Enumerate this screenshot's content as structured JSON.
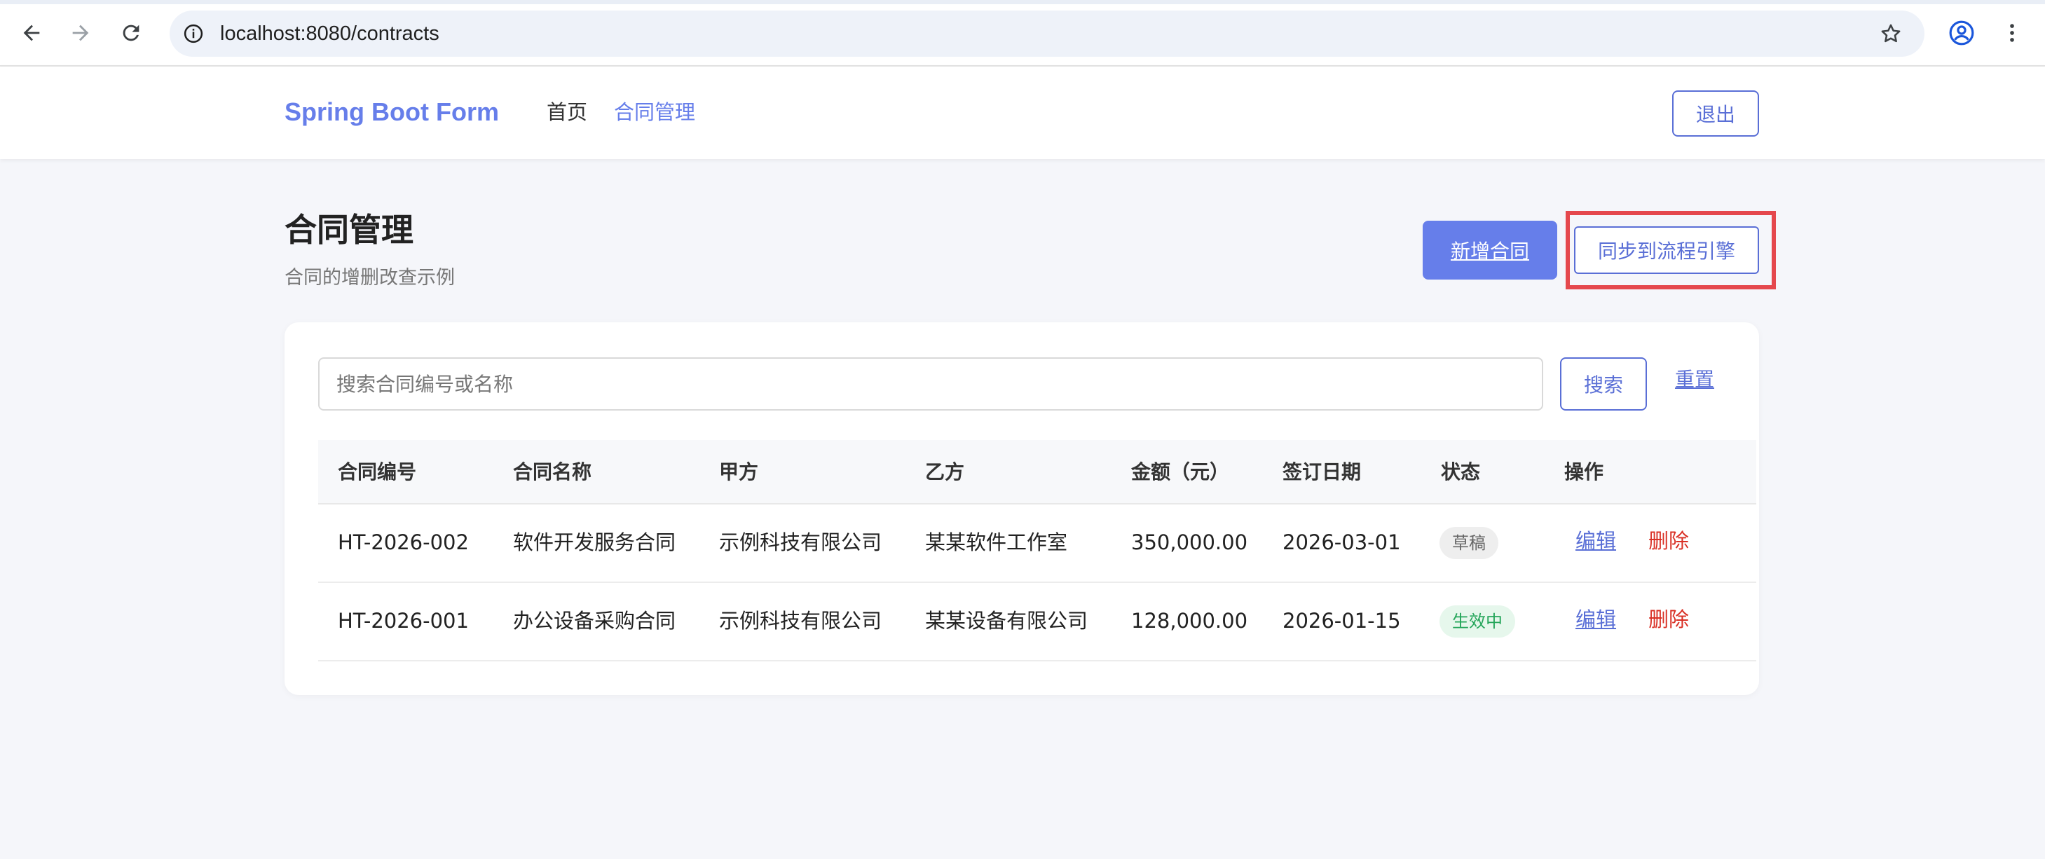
{
  "browser": {
    "url": "localhost:8080/contracts"
  },
  "navbar": {
    "brand": "Spring Boot Form",
    "links": [
      {
        "label": "首页"
      },
      {
        "label": "合同管理"
      }
    ],
    "logout_label": "退出"
  },
  "page": {
    "title": "合同管理",
    "subtitle": "合同的增删改查示例",
    "add_button_label": "新增合同",
    "sync_button_label": "同步到流程引擎"
  },
  "search": {
    "placeholder": "搜索合同编号或名称",
    "search_label": "搜索",
    "reset_label": "重置"
  },
  "table": {
    "headers": [
      "合同编号",
      "合同名称",
      "甲方",
      "乙方",
      "金额（元）",
      "签订日期",
      "状态",
      "操作"
    ],
    "rows": [
      {
        "code": "HT-2026-002",
        "name": "软件开发服务合同",
        "party_a": "示例科技有限公司",
        "party_b": "某某软件工作室",
        "amount": "350,000.00",
        "date": "2026-03-01",
        "status": "草稿",
        "edit": "编辑",
        "delete": "删除"
      },
      {
        "code": "HT-2026-001",
        "name": "办公设备采购合同",
        "party_a": "示例科技有限公司",
        "party_b": "某某设备有限公司",
        "amount": "128,000.00",
        "date": "2026-01-15",
        "status": "生效中",
        "edit": "编辑",
        "delete": "删除"
      }
    ]
  },
  "colors": {
    "brand": "#667eea",
    "highlight": "#e5484d",
    "delete": "#d93025",
    "status_active": "#23a559"
  }
}
